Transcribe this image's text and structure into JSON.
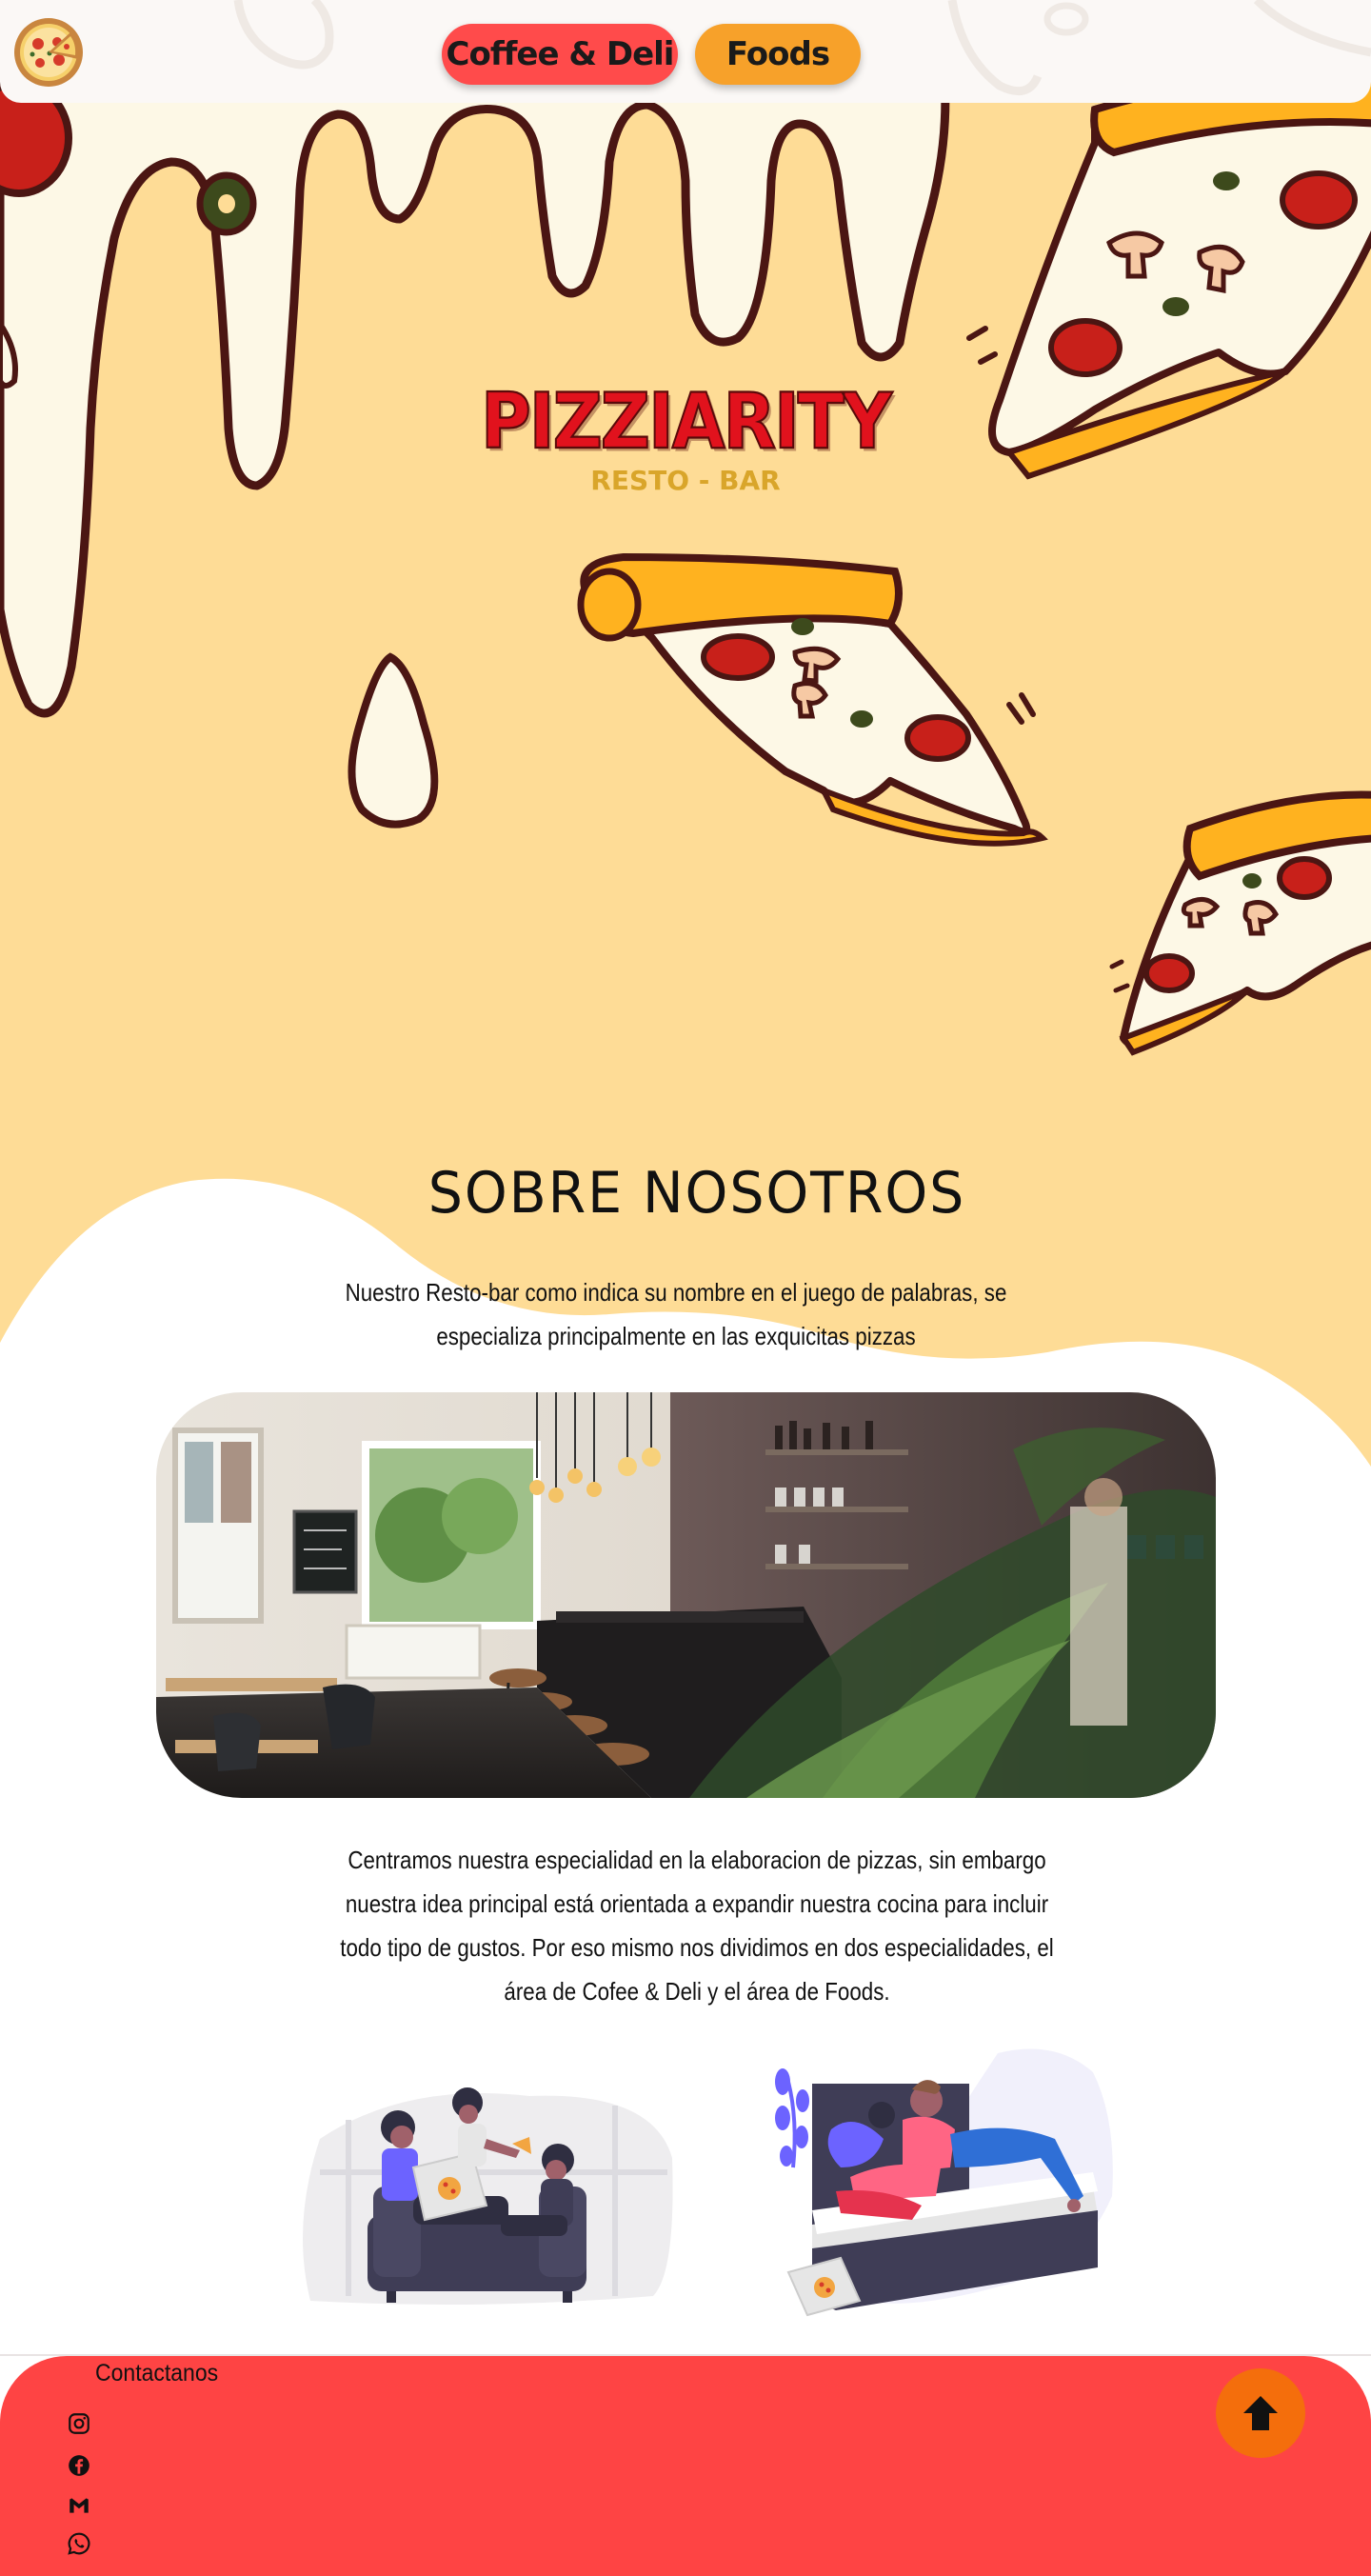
{
  "header": {
    "logo_icon": "pizza-logo-icon",
    "nav": [
      {
        "label": "Coffee & Deli",
        "color": "#ff4b4b"
      },
      {
        "label": "Foods",
        "color": "#f7a12a"
      }
    ]
  },
  "hero": {
    "title": "PIZZIARITY",
    "subtitle": "RESTO - BAR",
    "background": "#fedc96",
    "title_color": "#e1121d",
    "subtitle_color": "#d9a52a"
  },
  "about": {
    "title": "SOBRE NOSOTROS",
    "intro": "Nuestro Resto-bar como indica su nombre en el juego de palabras, se especializa principalmente en las exquicitas pizzas",
    "photo_icon": "restaurant-interior-photo",
    "body": "Centramos nuestra especialidad en la elaboracion de pizzas, sin embargo nuestra idea principal está orientada a expandir nuestra cocina para incluir todo tipo de gustos. Por eso mismo nos dividimos en dos especialidades, el área de Cofee & Deli y el área de Foods.",
    "illustrations": [
      "friends-eating-pizza-illustration",
      "couple-eating-pizza-illustration"
    ]
  },
  "footer": {
    "title": "Contactanos",
    "background": "#fe4444",
    "social": [
      "instagram-icon",
      "facebook-icon",
      "gmail-icon",
      "whatsapp-icon"
    ],
    "back_to_top_icon": "arrow-up-icon",
    "back_to_top_color": "#f46e0c"
  }
}
